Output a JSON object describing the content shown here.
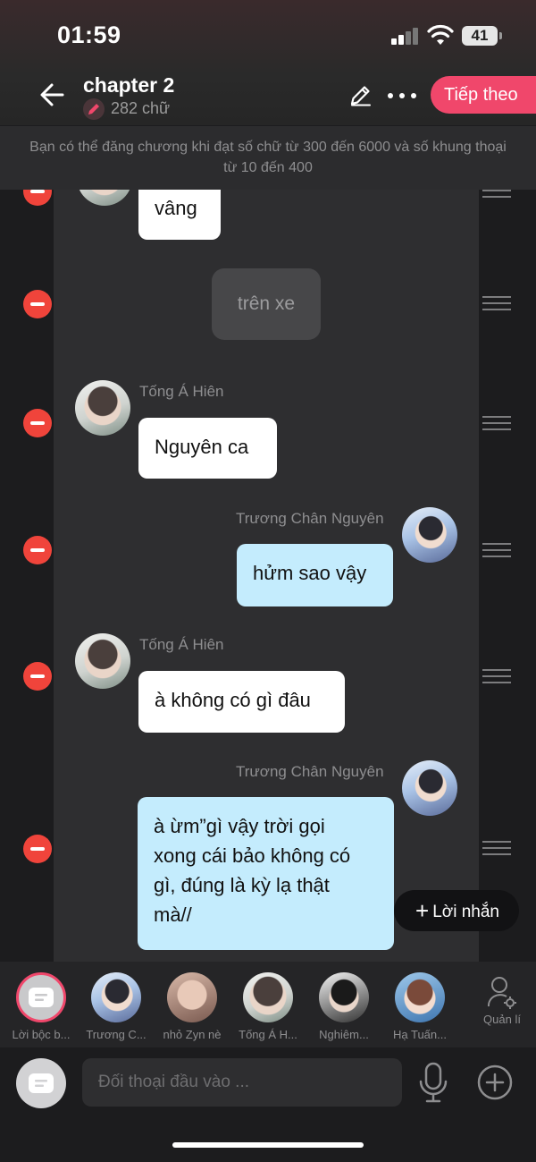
{
  "status": {
    "time": "01:59",
    "battery": "41"
  },
  "header": {
    "title": "chapter 2",
    "word_count": "282 chữ",
    "next_label": "Tiếp theo",
    "notice": "Bạn có thể đăng chương khi đạt số chữ từ 300 đến 6000 và số khung thoại từ 10 đến 400"
  },
  "messages": [
    {
      "type": "dialogue",
      "side": "left",
      "text": "vâng"
    },
    {
      "type": "narration",
      "text": "trên xe"
    },
    {
      "type": "dialogue",
      "side": "left",
      "speaker": "Tống Á Hiên",
      "text": "Nguyên ca"
    },
    {
      "type": "dialogue",
      "side": "right",
      "speaker": "Trương Chân Nguyên",
      "text": "hửm sao vậy"
    },
    {
      "type": "dialogue",
      "side": "left",
      "speaker": "Tống Á Hiên",
      "text": "à không có gì đâu"
    },
    {
      "type": "dialogue",
      "side": "right",
      "speaker": "Trương Chân Nguyên",
      "lines": [
        "à ừm”gì vậy trời gọi",
        "xong cái bảo không có",
        "gì, đúng là kỳ lạ thật",
        "mà//"
      ]
    }
  ],
  "add_message": {
    "label": "Lời nhắn"
  },
  "characters": [
    {
      "label": "Lời bộc b..."
    },
    {
      "label": "Trương C..."
    },
    {
      "label": "nhỏ Zyn nè"
    },
    {
      "label": "Tống Á H..."
    },
    {
      "label": "Nghiêm..."
    },
    {
      "label": "Hạ Tuấn..."
    }
  ],
  "manage_label": "Quản lí",
  "input": {
    "placeholder": "Đối thoại đầu vào ..."
  },
  "colors": {
    "accent": "#f0476b",
    "delete": "#f0443b",
    "outgoing_bubble": "#c4ecfd",
    "incoming_bubble": "#ffffff"
  }
}
